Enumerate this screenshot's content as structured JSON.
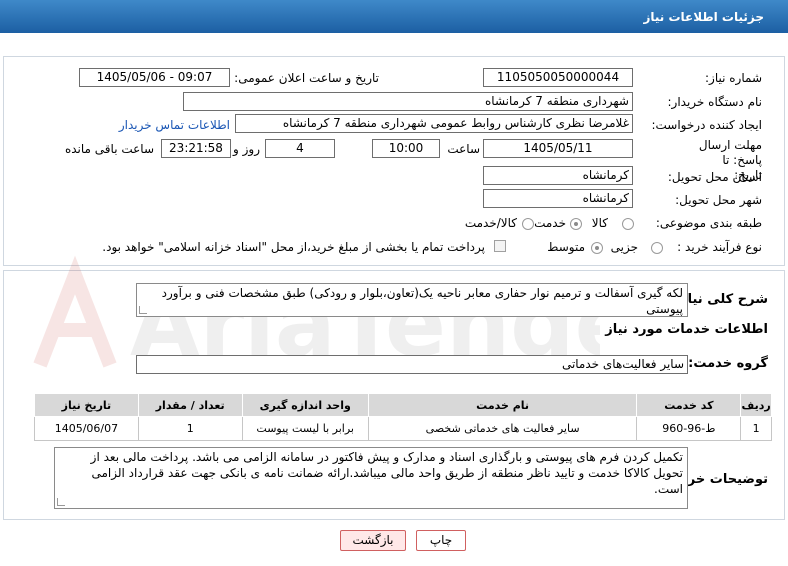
{
  "header": {
    "title": "جزئیات اطلاعات نیاز"
  },
  "fields": {
    "need_number_label": "شماره نیاز:",
    "need_number": "1105050050000044",
    "announce_datetime_label": "تاریخ و ساعت اعلان عمومی:",
    "announce_datetime": "1405/05/06 - 09:07",
    "buyer_org_label": "نام دستگاه خریدار:",
    "buyer_org": "شهرداری منطقه 7 کرمانشاه",
    "requester_label": "ایجاد کننده درخواست:",
    "requester": "غلامرضا نظری کارشناس روابط عمومی شهرداری منطقه 7 کرمانشاه",
    "buyer_contact_link": "اطلاعات تماس خریدار",
    "deadline_label": "مهلت ارسال پاسخ: تا تاریخ:",
    "deadline_date": "1405/05/11",
    "hour_label": "ساعت",
    "deadline_time": "10:00",
    "days_value": "4",
    "days_label": "روز و",
    "remaining_time": "23:21:58",
    "remaining_label": "ساعت باقی مانده",
    "province_label": "استان محل تحویل:",
    "province": "کرمانشاه",
    "city_label": "شهر محل تحویل:",
    "city": "کرمانشاه",
    "category_label": "طبقه بندی موضوعی:",
    "category_options": [
      "کالا",
      "خدمت",
      "کالا/خدمت"
    ],
    "category_selected": "خدمت",
    "process_label": "نوع فرآیند خرید :",
    "process_options": [
      "جزیی",
      "متوسط"
    ],
    "process_selected": "جزیی",
    "payment_note": "پرداخت تمام یا بخشی از مبلغ خرید،از محل \"اسناد خزانه اسلامی\" خواهد بود."
  },
  "description": {
    "label": "شرح کلی نیاز:",
    "text": "لکه گیری آسفالت و ترمیم نوار حفاری معابر ناحیه یک(تعاون،بلوار و رودکی) طبق مشخصات فنی و برآورد پیوستی"
  },
  "services": {
    "section_title": "اطلاعات خدمات مورد نیاز",
    "group_label": "گروه خدمت:",
    "group_value": "سایر فعالیت‌های خدماتی",
    "columns": [
      "ردیف",
      "کد خدمت",
      "نام خدمت",
      "واحد اندازه گیری",
      "تعداد / مقدار",
      "تاریخ نیاز"
    ],
    "rows": [
      [
        "1",
        "ط-96-960",
        "سایر فعالیت های خدماتی شخصی",
        "برابر با لیست پیوست",
        "1",
        "1405/06/07"
      ]
    ]
  },
  "buyer_notes": {
    "label": "توضیحات خریدار:",
    "text": "تکمیل کردن فرم های پیوستی و بارگذاری اسناد و مدارک و پیش فاکتور در سامانه الزامی می باشد. پرداخت مالی بعد از تحویل کالاکا خدمت و تایید ناظر منطقه از طریق واحد مالی میباشد.ارائه ضمانت نامه ی بانکی جهت عقد قرارداد الزامی است."
  },
  "buttons": {
    "print": "چاپ",
    "back": "بازگشت"
  },
  "watermark": {
    "text": "AriaTender.net"
  },
  "colors": {
    "header_bg": "#2a6fb5",
    "link": "#1a56b4",
    "button_border": "#d06060"
  }
}
